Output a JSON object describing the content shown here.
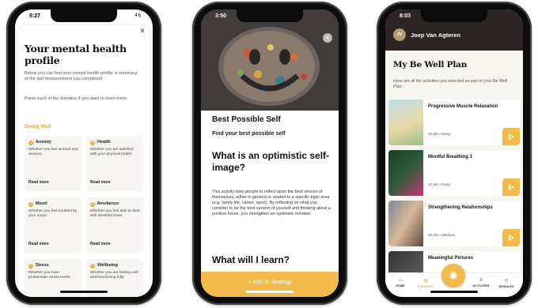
{
  "phone1": {
    "time": "5:27",
    "signal": "46",
    "title": "Your mental health profile",
    "close_icon": "×",
    "intro": "Below you can find your mental health profile: a summary of the last measurement you completed.",
    "instruction": "Press each of the domains if you want to learn more.",
    "section": "Doing Well",
    "domains": [
      {
        "name": "Anxiety",
        "text": "Whether you feel worried and anxious.",
        "more": "Read more"
      },
      {
        "name": "Health",
        "text": "Whether you are satisfied with your physical health.",
        "more": "Read more"
      },
      {
        "name": "Mood",
        "text": "Whether you feel troubled by your mood.",
        "more": "Read more"
      },
      {
        "name": "Resilience",
        "text": "Whether you feel able to deal with stressful times.",
        "more": "Read more"
      },
      {
        "name": "Stress",
        "text": "Whether you have problematic stress levels",
        "more": ""
      },
      {
        "name": "Wellbeing",
        "text": "Whether you are feeling well and functioning fully.",
        "more": ""
      }
    ]
  },
  "phone2": {
    "time": "3:50",
    "close_icon": "×",
    "title": "Best Possible Self",
    "subtitle": "Find your best possible self",
    "heading1": "What is an optimistic self-image?",
    "body": "This activity asks people to reflect upon the best version of themselves, either in general or related to a specific topic area (e.g. family life, career, sport). By reflecting on what you consider to be the best version of yourself and thinking about a positive future, you strengthen an optimistic mindset.",
    "heading2": "What will I learn?",
    "cta": "+ Add To Strategy"
  },
  "phone3": {
    "time": "8:03",
    "avatar": "JV",
    "user": "Joep Van Agteren",
    "title": "My Be Well Plan",
    "subtitle": "Here are all the activities you selected as part of your Be Well Plan.",
    "activities": [
      {
        "title": "Progressive Muscle Relaxation",
        "meta": "15 Min • Easy"
      },
      {
        "title": "Mindful Breathing 1",
        "meta": "10 Min • Easy"
      },
      {
        "title": "Strengthening Relationships",
        "meta": "20 Min • Medium"
      },
      {
        "title": "Meaningful Pictures",
        "meta": ""
      }
    ],
    "nav": [
      "HOME",
      "STRATEGY",
      "ACTIVITIES",
      "MODULES"
    ]
  }
}
